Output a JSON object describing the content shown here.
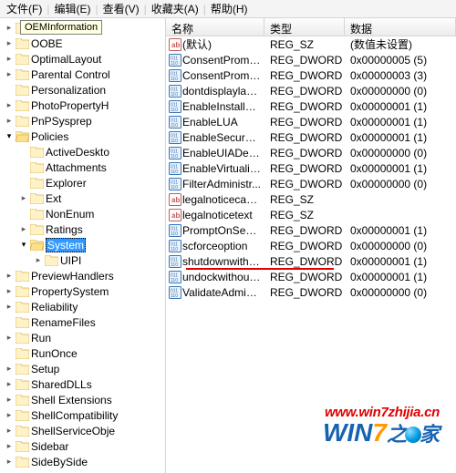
{
  "menubar": [
    "文件(F)",
    "编辑(E)",
    "查看(V)",
    "收藏夹(A)",
    "帮助(H)"
  ],
  "tooltip": "OEMInformation",
  "tree": [
    {
      "d": 1,
      "t": "c",
      "label": "OEM..."
    },
    {
      "d": 1,
      "t": "c",
      "label": "OOBE"
    },
    {
      "d": 1,
      "t": "c",
      "label": "OptimalLayout"
    },
    {
      "d": 1,
      "t": "c",
      "label": "Parental Control"
    },
    {
      "d": 1,
      "t": "n",
      "label": "Personalization"
    },
    {
      "d": 1,
      "t": "c",
      "label": "PhotoPropertyH"
    },
    {
      "d": 1,
      "t": "c",
      "label": "PnPSysprep"
    },
    {
      "d": 1,
      "t": "o",
      "label": "Policies"
    },
    {
      "d": 2,
      "t": "n",
      "label": "ActiveDeskto"
    },
    {
      "d": 2,
      "t": "n",
      "label": "Attachments"
    },
    {
      "d": 2,
      "t": "n",
      "label": "Explorer"
    },
    {
      "d": 2,
      "t": "c",
      "label": "Ext"
    },
    {
      "d": 2,
      "t": "n",
      "label": "NonEnum"
    },
    {
      "d": 2,
      "t": "c",
      "label": "Ratings"
    },
    {
      "d": 2,
      "t": "o",
      "label": "System",
      "sel": true
    },
    {
      "d": 3,
      "t": "c",
      "label": "UIPI"
    },
    {
      "d": 1,
      "t": "c",
      "label": "PreviewHandlers"
    },
    {
      "d": 1,
      "t": "c",
      "label": "PropertySystem"
    },
    {
      "d": 1,
      "t": "c",
      "label": "Reliability"
    },
    {
      "d": 1,
      "t": "n",
      "label": "RenameFiles"
    },
    {
      "d": 1,
      "t": "c",
      "label": "Run"
    },
    {
      "d": 1,
      "t": "n",
      "label": "RunOnce"
    },
    {
      "d": 1,
      "t": "c",
      "label": "Setup"
    },
    {
      "d": 1,
      "t": "c",
      "label": "SharedDLLs"
    },
    {
      "d": 1,
      "t": "c",
      "label": "Shell Extensions"
    },
    {
      "d": 1,
      "t": "c",
      "label": "ShellCompatibility"
    },
    {
      "d": 1,
      "t": "c",
      "label": "ShellServiceObje"
    },
    {
      "d": 1,
      "t": "c",
      "label": "Sidebar"
    },
    {
      "d": 1,
      "t": "c",
      "label": "SideBySide"
    }
  ],
  "columns": {
    "name": "名称",
    "type": "类型",
    "data": "数据"
  },
  "rows": [
    {
      "icon": "sz",
      "name": "(默认)",
      "type": "REG_SZ",
      "data": "(数值未设置)"
    },
    {
      "icon": "dw",
      "name": "ConsentPromp...",
      "type": "REG_DWORD",
      "data": "0x00000005 (5)"
    },
    {
      "icon": "dw",
      "name": "ConsentPromp...",
      "type": "REG_DWORD",
      "data": "0x00000003 (3)"
    },
    {
      "icon": "dw",
      "name": "dontdisplaylas...",
      "type": "REG_DWORD",
      "data": "0x00000000 (0)"
    },
    {
      "icon": "dw",
      "name": "EnableInstaller...",
      "type": "REG_DWORD",
      "data": "0x00000001 (1)"
    },
    {
      "icon": "dw",
      "name": "EnableLUA",
      "type": "REG_DWORD",
      "data": "0x00000001 (1)"
    },
    {
      "icon": "dw",
      "name": "EnableSecureU...",
      "type": "REG_DWORD",
      "data": "0x00000001 (1)"
    },
    {
      "icon": "dw",
      "name": "EnableUIADes...",
      "type": "REG_DWORD",
      "data": "0x00000000 (0)"
    },
    {
      "icon": "dw",
      "name": "EnableVirtualiz...",
      "type": "REG_DWORD",
      "data": "0x00000001 (1)"
    },
    {
      "icon": "dw",
      "name": "FilterAdministr...",
      "type": "REG_DWORD",
      "data": "0x00000000 (0)"
    },
    {
      "icon": "sz",
      "name": "legalnoticecap...",
      "type": "REG_SZ",
      "data": ""
    },
    {
      "icon": "sz",
      "name": "legalnoticetext",
      "type": "REG_SZ",
      "data": ""
    },
    {
      "icon": "dw",
      "name": "PromptOnSecu...",
      "type": "REG_DWORD",
      "data": "0x00000001 (1)"
    },
    {
      "icon": "dw",
      "name": "scforceoption",
      "type": "REG_DWORD",
      "data": "0x00000000 (0)"
    },
    {
      "icon": "dw",
      "name": "shutdownwitho...",
      "type": "REG_DWORD",
      "data": "0x00000001 (1)",
      "hl": true
    },
    {
      "icon": "dw",
      "name": "undockwithout...",
      "type": "REG_DWORD",
      "data": "0x00000001 (1)"
    },
    {
      "icon": "dw",
      "name": "ValidateAdmin...",
      "type": "REG_DWORD",
      "data": "0x00000000 (0)"
    }
  ],
  "watermark": {
    "url": "www.win7zhijia.cn",
    "brand_win": "W",
    "brand_in": "IN",
    "brand_7": "7",
    "brand_suf": "家"
  }
}
